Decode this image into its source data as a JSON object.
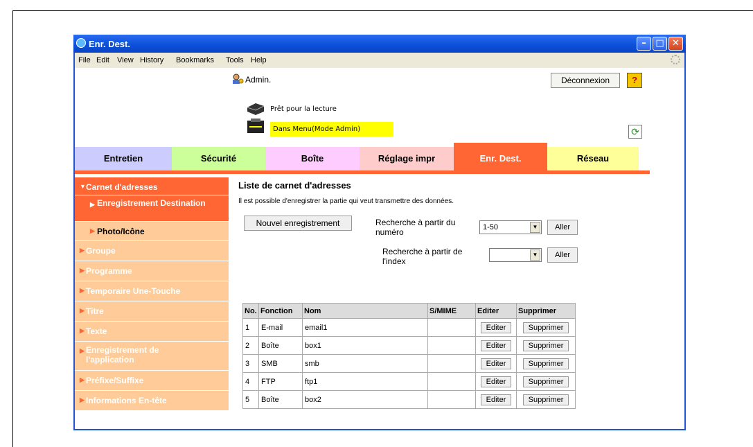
{
  "window": {
    "title": "Enr. Dest."
  },
  "menu": [
    "File",
    "Edit",
    "View",
    "History",
    "Bookmarks",
    "Tools",
    "Help"
  ],
  "header": {
    "user": "Admin.",
    "logout_label": "Déconnexion",
    "help_label": "?",
    "status_ready": "Prêt pour la lecture",
    "status_mode": "Dans Menu(Mode Admin)"
  },
  "tabs": [
    "Entretien",
    "Sécurité",
    "Boîte",
    "Réglage impr",
    "Enr. Dest.",
    "Réseau"
  ],
  "sidebar": [
    "Carnet d'adresses",
    "Enregistrement Destination",
    "Photo/Icône",
    "Groupe",
    "Programme",
    "Temporaire Une-Touche",
    "Titre",
    "Texte",
    "Enregistrement de l'application",
    "Préfixe/Suffixe",
    "Informations En-tête"
  ],
  "main": {
    "title": "Liste de carnet d'adresses",
    "description": "Il est possible d'enregistrer la partie qui veut transmettre des données.",
    "new_button": "Nouvel enregistrement",
    "search_number_label": "Recherche à partir du numéro",
    "search_number_value": "1-50",
    "search_index_label": "Recherche à partir de l'index",
    "search_index_value": "",
    "go_label": "Aller"
  },
  "table": {
    "headers": [
      "No.",
      "Fonction",
      "Nom",
      "S/MIME",
      "Editer",
      "Supprimer"
    ],
    "rows": [
      [
        "1",
        "E-mail",
        "email1",
        ""
      ],
      [
        "2",
        "Boîte",
        "box1",
        ""
      ],
      [
        "3",
        "SMB",
        "smb",
        ""
      ],
      [
        "4",
        "FTP",
        "ftp1",
        ""
      ],
      [
        "5",
        "Boîte",
        "box2",
        ""
      ]
    ],
    "edit_label": "Editer",
    "delete_label": "Supprimer"
  }
}
